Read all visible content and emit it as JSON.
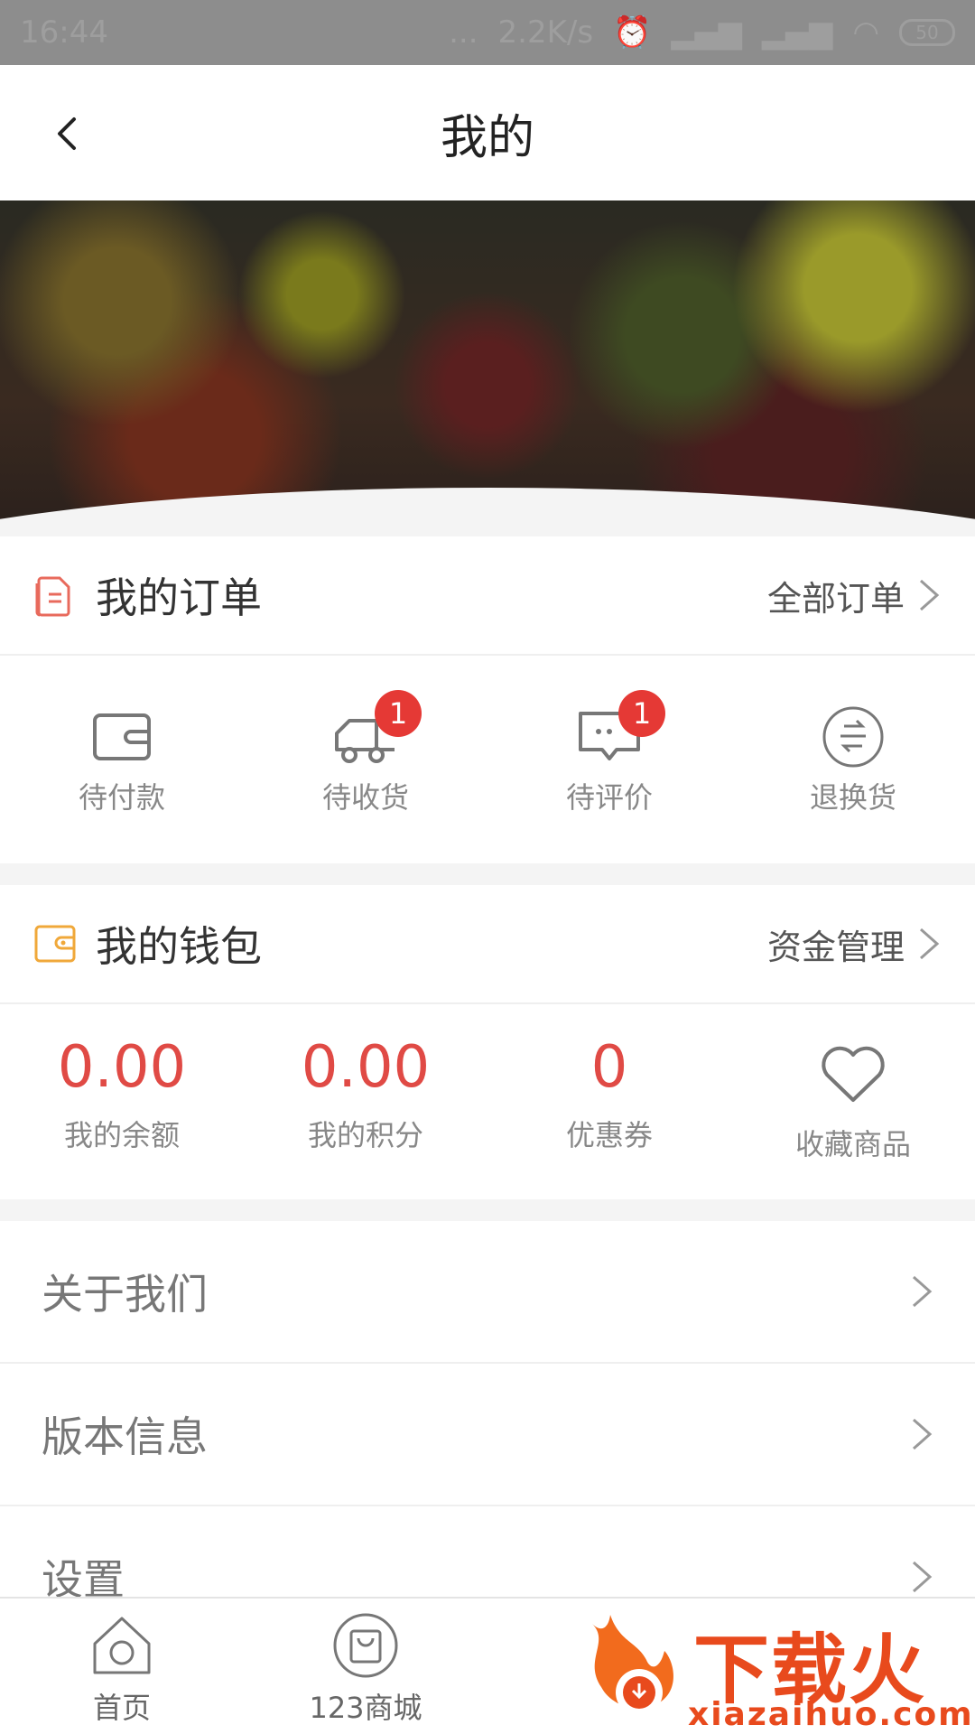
{
  "status_bar": {
    "time": "16:44",
    "speed": "2.2K/s",
    "dots": "...",
    "battery": "50"
  },
  "title_bar": {
    "title": "我的"
  },
  "orders": {
    "title": "我的订单",
    "link": "全部订单",
    "items": [
      {
        "label": "待付款",
        "icon": "wallet-icon",
        "badge": ""
      },
      {
        "label": "待收货",
        "icon": "truck-icon",
        "badge": "1"
      },
      {
        "label": "待评价",
        "icon": "comment-icon",
        "badge": "1"
      },
      {
        "label": "退换货",
        "icon": "exchange-icon",
        "badge": ""
      }
    ]
  },
  "wallet": {
    "title": "我的钱包",
    "link": "资金管理",
    "items": [
      {
        "value": "0.00",
        "label": "我的余额"
      },
      {
        "value": "0.00",
        "label": "我的积分"
      },
      {
        "value": "0",
        "label": "优惠券"
      },
      {
        "label": "收藏商品",
        "icon": "heart-icon"
      }
    ]
  },
  "menu": [
    {
      "label": "关于我们"
    },
    {
      "label": "版本信息"
    },
    {
      "label": "设置"
    }
  ],
  "bottom_nav": [
    {
      "label": "首页",
      "icon": "home-icon"
    },
    {
      "label": "123商城",
      "icon": "shopping-bag-icon"
    }
  ],
  "watermark": {
    "brand": "下载火",
    "url": "xiazaihuo.com"
  },
  "colors": {
    "accent": "#e04a45",
    "badge": "#e53935",
    "order_icon": "#e86a5c",
    "wallet_icon": "#f0a83a"
  }
}
